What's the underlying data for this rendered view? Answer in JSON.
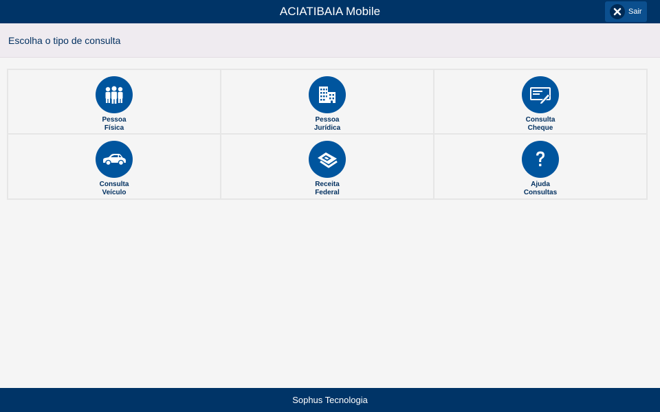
{
  "header": {
    "title": "ACIATIBAIA Mobile",
    "exit_label": "Sair",
    "exit_icon": "close-x-icon"
  },
  "subheader": {
    "title": "Escolha o tipo de consulta"
  },
  "tiles": [
    {
      "line1": "Pessoa",
      "line2": "Física",
      "icon": "people-icon"
    },
    {
      "line1": "Pessoa",
      "line2": "Jurídica",
      "icon": "buildings-icon"
    },
    {
      "line1": "Consulta",
      "line2": "Cheque",
      "icon": "check-icon"
    },
    {
      "line1": "Consulta",
      "line2": "Veículo",
      "icon": "car-icon"
    },
    {
      "line1": "Receita",
      "line2": "Federal",
      "icon": "receita-federal-icon"
    },
    {
      "line1": "Ajuda",
      "line2": "Consultas",
      "icon": "help-question-icon"
    }
  ],
  "footer": {
    "text": "Sophus Tecnologia"
  },
  "colors": {
    "header_bg": "#003467",
    "accent": "#00559e",
    "subheader_bg": "#efebf0",
    "page_bg": "#f5f5f5"
  }
}
